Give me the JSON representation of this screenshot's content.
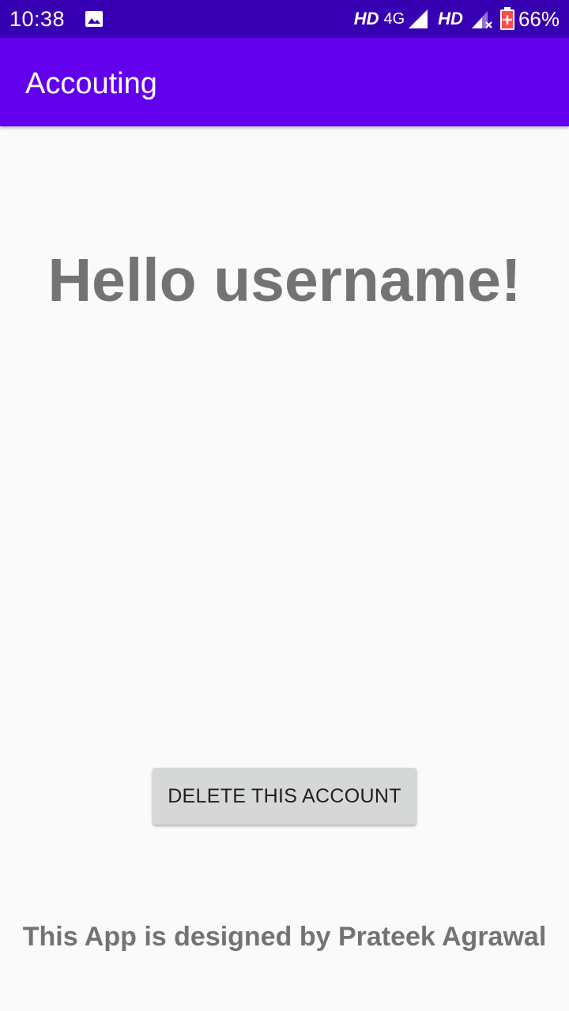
{
  "status_bar": {
    "time": "10:38",
    "hd_label_1": "HD",
    "network_label": "4G",
    "hd_label_2": "HD",
    "battery_percent": "66%",
    "battery_level": 0.66,
    "icons": [
      "gallery-icon",
      "signal-icon",
      "signal-no-sim-icon",
      "battery-icon"
    ]
  },
  "app_bar": {
    "title": "Accouting",
    "color": "#6200ee"
  },
  "main": {
    "greeting": "Hello username!",
    "delete_button_label": "DELETE THIS ACCOUNT",
    "footer": "This App is designed by Prateek Agrawal"
  },
  "colors": {
    "status_bar": "#3700b3",
    "app_bar": "#6200ee",
    "background": "#fafafa",
    "text_gray": "#737373",
    "button": "#d6d7d7"
  }
}
